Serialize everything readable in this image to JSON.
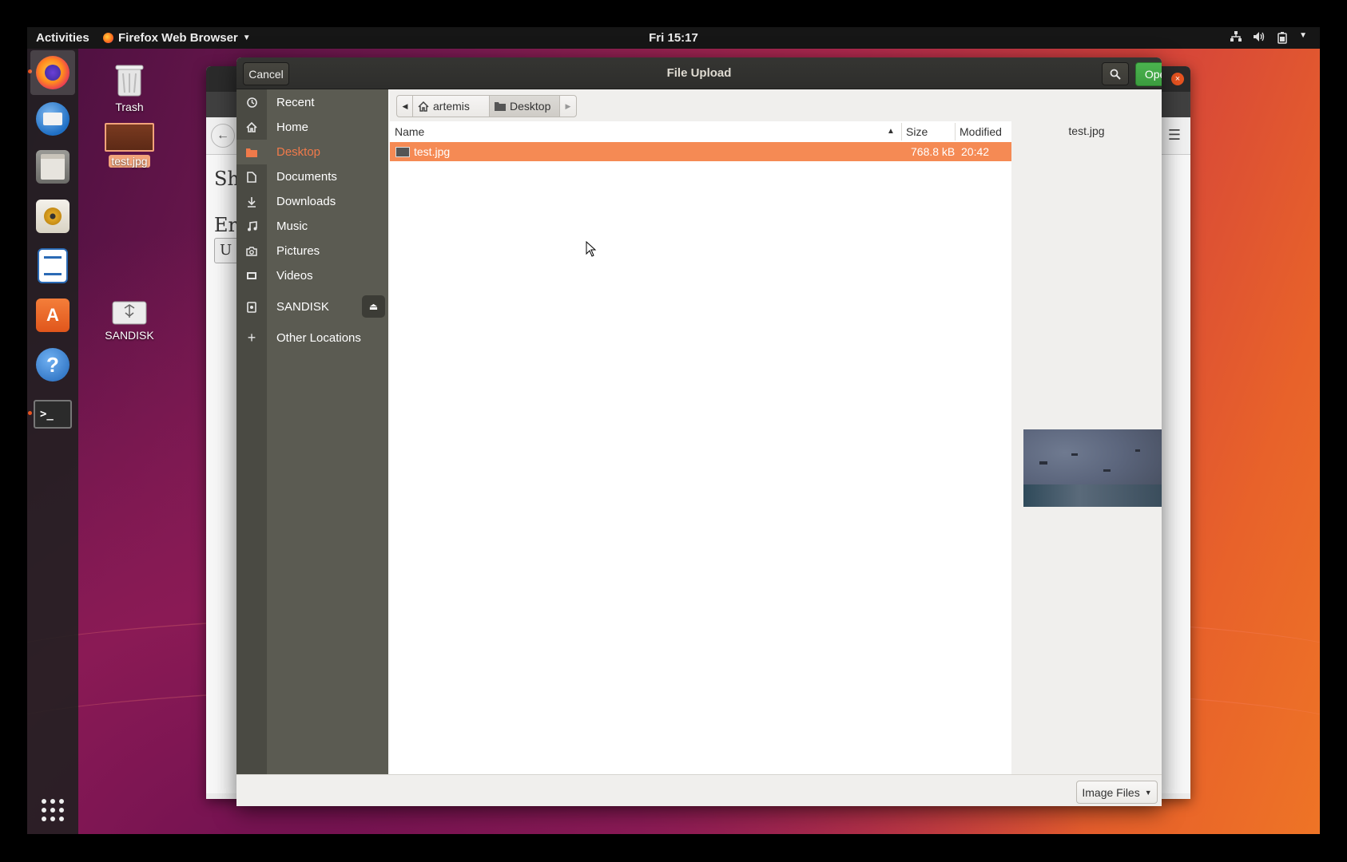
{
  "topbar": {
    "activities": "Activities",
    "app_menu": "Firefox Web Browser",
    "clock": "Fri 15:17"
  },
  "dock": {
    "items": [
      "firefox-icon",
      "thunderbird-icon",
      "files-icon",
      "rhythmbox-icon",
      "libreoffice-writer-icon",
      "ubuntu-software-icon",
      "help-icon",
      "terminal-icon"
    ],
    "show_apps": "show-applications-icon"
  },
  "desktop": {
    "icons": [
      {
        "label": "Trash"
      },
      {
        "label": "test.jpg"
      },
      {
        "label": "SANDISK"
      }
    ]
  },
  "background_window": {
    "page_text_1": "Sh",
    "page_text_2": "Er",
    "page_text_3": "U"
  },
  "dialog": {
    "title": "File Upload",
    "cancel_label": "Cancel",
    "open_label": "Open",
    "sidebar": [
      {
        "label": "Recent",
        "icon": "clock-icon"
      },
      {
        "label": "Home",
        "icon": "home-icon"
      },
      {
        "label": "Desktop",
        "icon": "folder-icon"
      },
      {
        "label": "Documents",
        "icon": "document-icon"
      },
      {
        "label": "Downloads",
        "icon": "download-icon"
      },
      {
        "label": "Music",
        "icon": "music-icon"
      },
      {
        "label": "Pictures",
        "icon": "camera-icon"
      },
      {
        "label": "Videos",
        "icon": "video-icon"
      },
      {
        "label": "SANDISK",
        "icon": "drive-icon"
      },
      {
        "label": "Other Locations",
        "icon": "plus-icon"
      }
    ],
    "pathbar": {
      "segments": [
        "artemis",
        "Desktop"
      ]
    },
    "columns": {
      "name": "Name",
      "size": "Size",
      "modified": "Modified"
    },
    "files": [
      {
        "name": "test.jpg",
        "size": "768.8 kB",
        "modified": "20:42",
        "selected": true
      }
    ],
    "preview_name": "test.jpg",
    "filter": "Image Files"
  },
  "colors": {
    "selection": "#f58a54",
    "open_button": "#4bb34f",
    "ubuntu_orange": "#e95420"
  }
}
